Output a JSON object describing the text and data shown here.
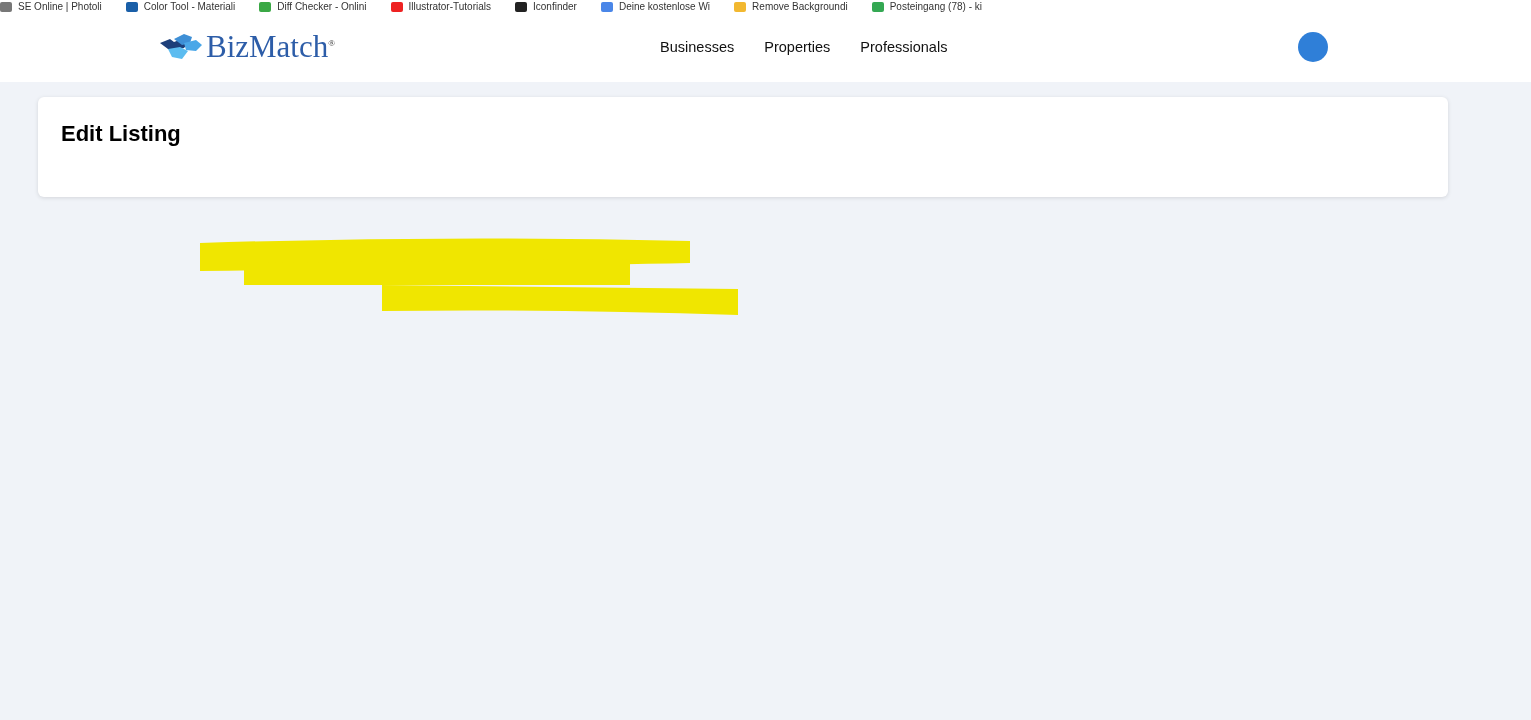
{
  "bookmarks": [
    {
      "label": "SE Online | Photoli"
    },
    {
      "label": "Color Tool - Materiali"
    },
    {
      "label": "Diff Checker - Onlini"
    },
    {
      "label": "Illustrator-Tutorials"
    },
    {
      "label": "Iconfinder"
    },
    {
      "label": "Deine kostenlose Wi"
    },
    {
      "label": "Remove Backgroundi"
    },
    {
      "label": "Posteingang (78) - ki"
    }
  ],
  "header": {
    "logo": "BizMatch",
    "logo_mark": "®",
    "nav": [
      {
        "label": "Businesses"
      },
      {
        "label": "Properties"
      },
      {
        "label": "Professionals"
      }
    ]
  },
  "card": {
    "title": "Edit Listing"
  }
}
